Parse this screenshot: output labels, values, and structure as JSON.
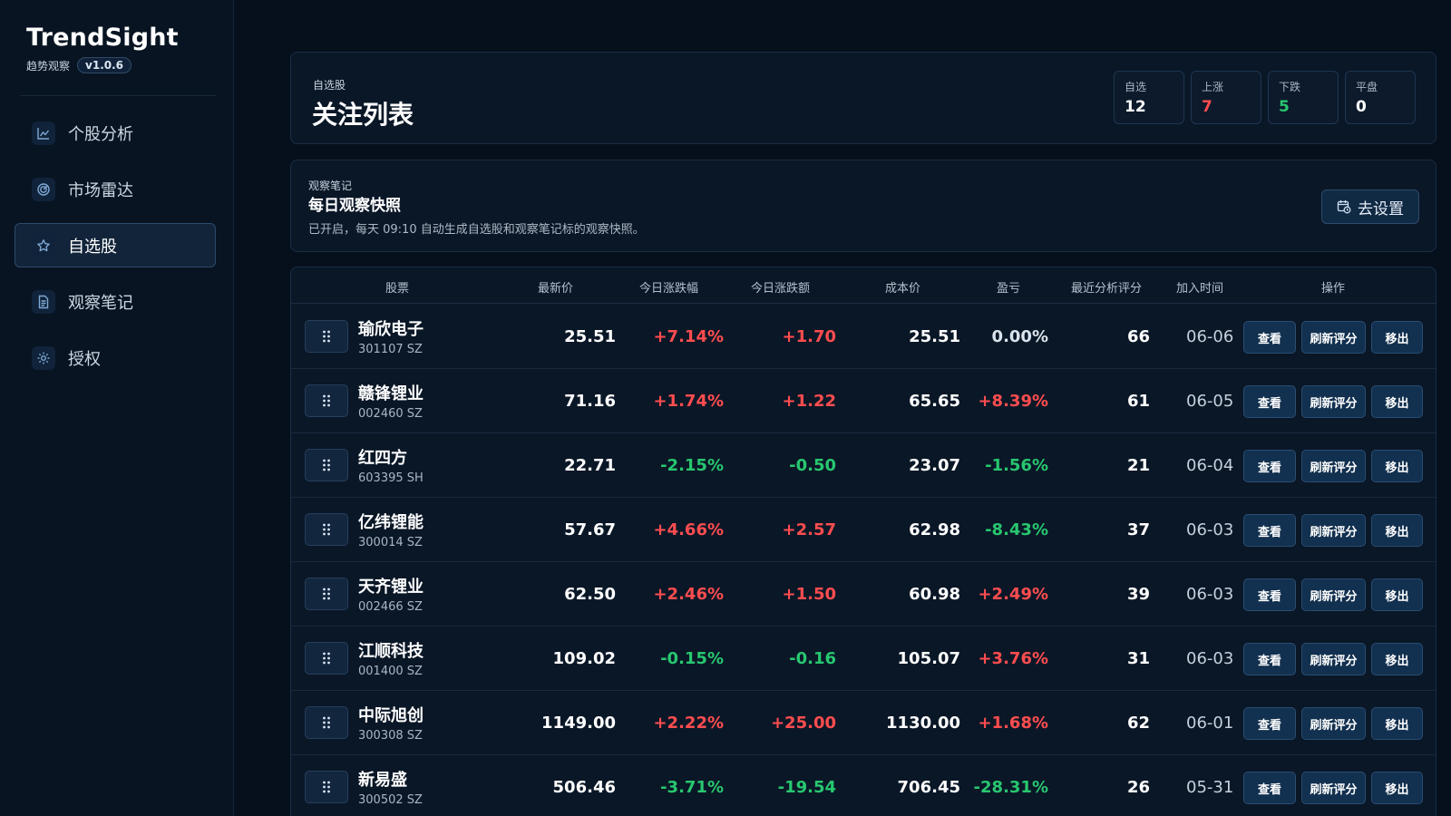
{
  "brand": {
    "name": "TrendSight",
    "subtitle": "趋势观察",
    "version": "v1.0.6"
  },
  "nav": [
    {
      "label": "个股分析",
      "icon": "chart-icon",
      "active": false
    },
    {
      "label": "市场雷达",
      "icon": "radar-icon",
      "active": false
    },
    {
      "label": "自选股",
      "icon": "star-icon",
      "active": true
    },
    {
      "label": "观察笔记",
      "icon": "document-icon",
      "active": false
    },
    {
      "label": "授权",
      "icon": "gear-icon",
      "active": false
    }
  ],
  "header": {
    "subtitle": "自选股",
    "title": "关注列表",
    "stats": [
      {
        "label": "自选",
        "value": "12",
        "tone": "neutral"
      },
      {
        "label": "上涨",
        "value": "7",
        "tone": "up"
      },
      {
        "label": "下跌",
        "value": "5",
        "tone": "down"
      },
      {
        "label": "平盘",
        "value": "0",
        "tone": "flat"
      }
    ]
  },
  "note": {
    "subtitle": "观察笔记",
    "title": "每日观察快照",
    "desc": "已开启，每天 09:10 自动生成自选股和观察笔记标的观察快照。",
    "button": "去设置"
  },
  "table": {
    "headers": [
      "股票",
      "最新价",
      "今日涨跌幅",
      "今日涨跌额",
      "成本价",
      "盈亏",
      "最近分析评分",
      "加入时间",
      "操作"
    ],
    "actions": {
      "view": "查看",
      "refresh": "刷新评分",
      "remove": "移出"
    },
    "rows": [
      {
        "name": "瑜欣电子",
        "code": "301107 SZ",
        "price": "25.51",
        "pct": "+7.14%",
        "amt": "+1.70",
        "cost": "25.51",
        "pnl": "0.00%",
        "score": "66",
        "date": "06-06",
        "dir": "up",
        "pnl_dir": "flat"
      },
      {
        "name": "赣锋锂业",
        "code": "002460 SZ",
        "price": "71.16",
        "pct": "+1.74%",
        "amt": "+1.22",
        "cost": "65.65",
        "pnl": "+8.39%",
        "score": "61",
        "date": "06-05",
        "dir": "up",
        "pnl_dir": "up"
      },
      {
        "name": "红四方",
        "code": "603395 SH",
        "price": "22.71",
        "pct": "-2.15%",
        "amt": "-0.50",
        "cost": "23.07",
        "pnl": "-1.56%",
        "score": "21",
        "date": "06-04",
        "dir": "down",
        "pnl_dir": "down"
      },
      {
        "name": "亿纬锂能",
        "code": "300014 SZ",
        "price": "57.67",
        "pct": "+4.66%",
        "amt": "+2.57",
        "cost": "62.98",
        "pnl": "-8.43%",
        "score": "37",
        "date": "06-03",
        "dir": "up",
        "pnl_dir": "down"
      },
      {
        "name": "天齐锂业",
        "code": "002466 SZ",
        "price": "62.50",
        "pct": "+2.46%",
        "amt": "+1.50",
        "cost": "60.98",
        "pnl": "+2.49%",
        "score": "39",
        "date": "06-03",
        "dir": "up",
        "pnl_dir": "up"
      },
      {
        "name": "江顺科技",
        "code": "001400 SZ",
        "price": "109.02",
        "pct": "-0.15%",
        "amt": "-0.16",
        "cost": "105.07",
        "pnl": "+3.76%",
        "score": "31",
        "date": "06-03",
        "dir": "down",
        "pnl_dir": "up"
      },
      {
        "name": "中际旭创",
        "code": "300308 SZ",
        "price": "1149.00",
        "pct": "+2.22%",
        "amt": "+25.00",
        "cost": "1130.00",
        "pnl": "+1.68%",
        "score": "62",
        "date": "06-01",
        "dir": "up",
        "pnl_dir": "up"
      },
      {
        "name": "新易盛",
        "code": "300502 SZ",
        "price": "506.46",
        "pct": "-3.71%",
        "amt": "-19.54",
        "cost": "706.45",
        "pnl": "-28.31%",
        "score": "26",
        "date": "05-31",
        "dir": "down",
        "pnl_dir": "down"
      }
    ]
  },
  "colors": {
    "up": "#ff4d4f",
    "down": "#28c76f",
    "accent": "#12304f",
    "background": "#06101c"
  }
}
